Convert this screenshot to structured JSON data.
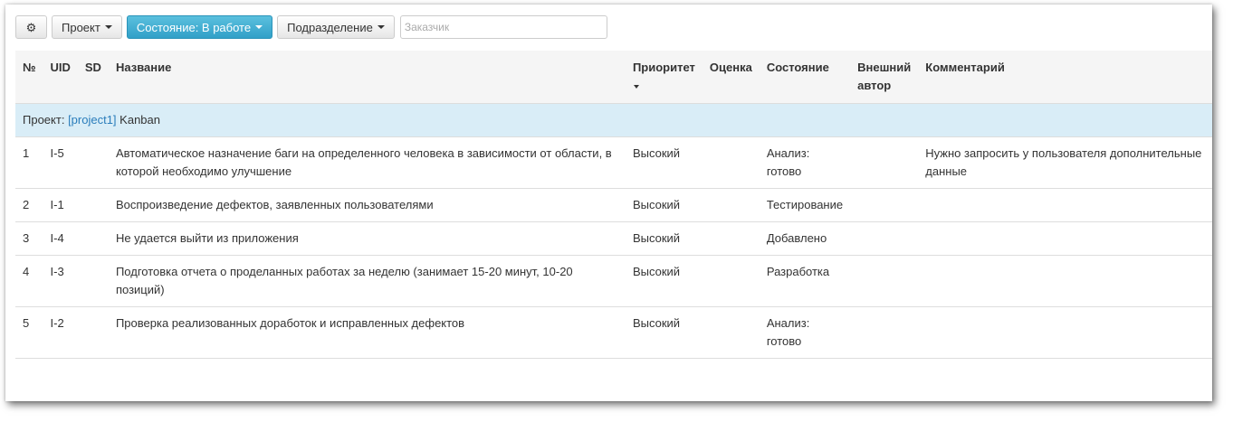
{
  "toolbar": {
    "settings_icon": "gear-icon",
    "project_label": "Проект",
    "state_label": "Состояние: В работе",
    "division_label": "Подразделение",
    "customer_placeholder": "Заказчик"
  },
  "colors": {
    "primary_button": "#31a0c8",
    "group_row": "#d9edf7",
    "link": "#2a7dbb"
  },
  "table": {
    "headers": {
      "no": "№",
      "uid": "UID",
      "sd": "SD",
      "name": "Название",
      "priority": "Приоритет",
      "estimate": "Оценка",
      "state": "Состояние",
      "author_line1": "Внешний",
      "author_line2": "автор",
      "comment": "Комментарий"
    },
    "group": {
      "label": "Проект:",
      "link": "[project1]",
      "name": "Kanban"
    },
    "rows": [
      {
        "no": "1",
        "uid": "I-5",
        "sd": "",
        "name": "Автоматическое назначение баги на определенного человека в зависимости от области, в которой необходимо улучшение",
        "priority": "Высокий",
        "estimate": "",
        "state": "Анализ: готово",
        "author": "",
        "comment": "Нужно запросить у пользователя дополнительные данные"
      },
      {
        "no": "2",
        "uid": "I-1",
        "sd": "",
        "name": "Воспроизведение дефектов, заявленных пользователями",
        "priority": "Высокий",
        "estimate": "",
        "state": "Тестирование",
        "author": "",
        "comment": ""
      },
      {
        "no": "3",
        "uid": "I-4",
        "sd": "",
        "name": "Не удается выйти из приложения",
        "priority": "Высокий",
        "estimate": "",
        "state": "Добавлено",
        "author": "",
        "comment": ""
      },
      {
        "no": "4",
        "uid": "I-3",
        "sd": "",
        "name": "Подготовка отчета о проделанных работах за неделю (занимает 15-20 минут, 10-20 позиций)",
        "priority": "Высокий",
        "estimate": "",
        "state": "Разработка",
        "author": "",
        "comment": ""
      },
      {
        "no": "5",
        "uid": "I-2",
        "sd": "",
        "name": "Проверка реализованных доработок и исправленных дефектов",
        "priority": "Высокий",
        "estimate": "",
        "state": "Анализ: готово",
        "author": "",
        "comment": ""
      }
    ]
  }
}
